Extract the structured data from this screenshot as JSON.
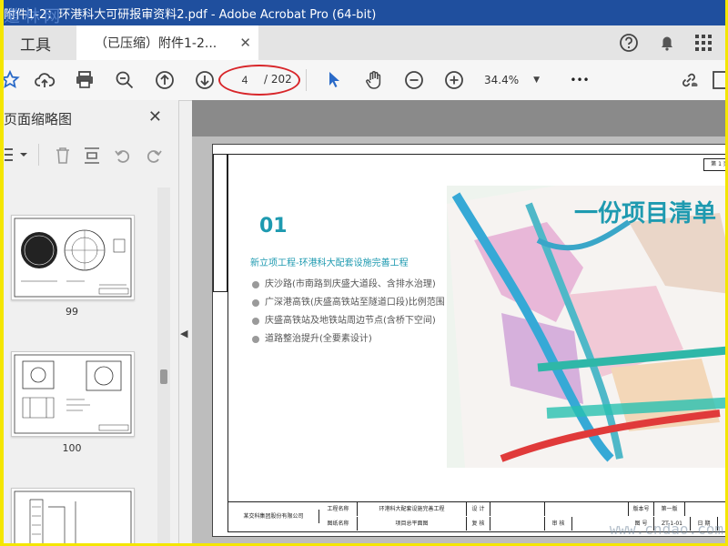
{
  "window": {
    "title": "附件1-2：环港科大可研报审资料2.pdf - Adobe Acrobat Pro (64-bit)",
    "title_prefix": "道",
    "watermark": "道林网"
  },
  "tabs": {
    "tools": "工具",
    "document": "（已压缩）附件1-2...",
    "close_symbol": "✕"
  },
  "toolbar": {
    "page_current": "4",
    "page_total": "/ 202",
    "zoom": "34.4%",
    "zoom_arrow": "▼",
    "more": "•••"
  },
  "panel": {
    "title": "页面缩略图",
    "close_symbol": "✕",
    "thumbnails": [
      {
        "label": "99"
      },
      {
        "label": "100"
      }
    ],
    "collapse_symbol": "◀"
  },
  "document": {
    "sheet_no": "第 1 页",
    "number": "01",
    "headline": "一份项目清单",
    "subtitle": "新立项工程-环港科大配套设施完善工程",
    "bullets": [
      "庆沙路(市南路到庆盛大道段、含排水治理)",
      "广深港高铁(庆盛高铁站至隧道口段)比例范围",
      "庆盛高铁站及地铁站周边节点(含桥下空间)",
      "道路整治提升(全要素设计)"
    ],
    "title_block": {
      "company": "某交科集团股份有限公司",
      "project_label": "工程名称",
      "project_name": "环港科大配套设施完善工程",
      "drawing_label": "图纸名称",
      "drawing_name": "项目总平面图",
      "design": "设 计",
      "review": "复 核",
      "approve": "审 核",
      "version": "版本号",
      "version_val": "第一版",
      "drawing_no_label": "图 号",
      "drawing_no": "ZT-1-01",
      "date_label": "日 期"
    },
    "corner_watermark": "www.cndao.com"
  },
  "colors": {
    "titlebar": "#1f4f9e",
    "accent": "#1e9ab0",
    "highlight_circle": "#d8262a"
  }
}
